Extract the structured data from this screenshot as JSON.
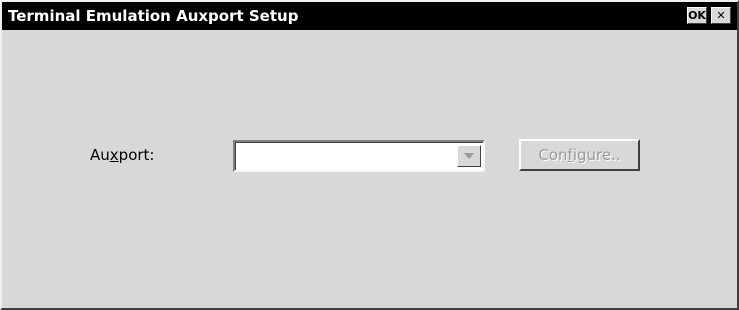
{
  "window": {
    "title": "Terminal Emulation Auxport Setup",
    "ok_label": "OK",
    "close_label": "✕"
  },
  "form": {
    "auxport_label_prefix": "Au",
    "auxport_label_accel": "x",
    "auxport_label_suffix": "port:",
    "auxport_value": "",
    "configure_prefix": "Con",
    "configure_accel": "f",
    "configure_suffix": "igure.."
  },
  "colors": {
    "dialog_bg": "#d8d8d8",
    "titlebar_bg": "#000000",
    "disabled_text": "#9a9a9a"
  },
  "icons": {
    "ok": "ok-icon",
    "close": "close-icon",
    "dropdown": "chevron-down-icon"
  }
}
